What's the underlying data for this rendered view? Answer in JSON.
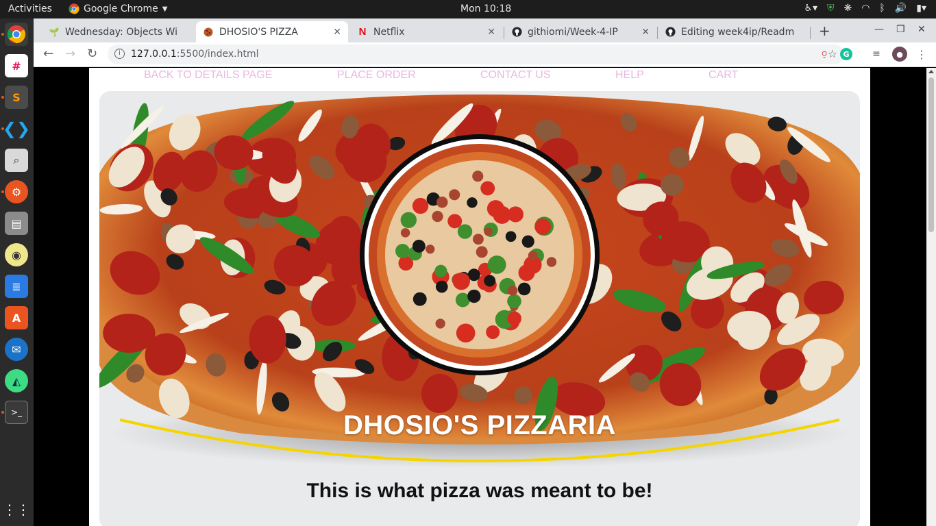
{
  "topbar": {
    "activities": "Activities",
    "app_name": "Google Chrome",
    "clock": "Mon 10:18"
  },
  "dock": {
    "items": [
      "chrome-icon",
      "slack-icon",
      "sublime-text-icon",
      "vscode-icon",
      "screenshot-icon",
      "settings-tools-icon",
      "files-icon",
      "rhythmbox-icon",
      "text-editor-icon",
      "software-center-icon",
      "thunderbird-icon",
      "android-studio-icon",
      "terminal-icon",
      "show-apps-icon"
    ]
  },
  "browser": {
    "tabs": [
      {
        "title": "Wednesday: Objects Wi",
        "favicon": "sprout-icon"
      },
      {
        "title": "DHOSIO'S PIZZA",
        "favicon": "pizza-icon",
        "active": true
      },
      {
        "title": "Netflix",
        "favicon": "netflix-icon"
      },
      {
        "title": "githiomi/Week-4-IP",
        "favicon": "github-icon"
      },
      {
        "title": "Editing week4ip/Readm",
        "favicon": "github-icon"
      }
    ],
    "url_host": "127.0.0.1",
    "url_rest": ":5500/index.html"
  },
  "site": {
    "nav": [
      "BACK TO DETAILS PAGE",
      "PLACE ORDER",
      "CONTACT US",
      "HELP",
      "CART"
    ],
    "hero_title": "DHOSIO'S PIZZARIA",
    "tagline": "This is what pizza was meant to be!"
  },
  "colors": {
    "nav_link": "#e9b7e2",
    "hero_bg": "#e9eaec",
    "accent_swoosh": "#f5d400"
  }
}
